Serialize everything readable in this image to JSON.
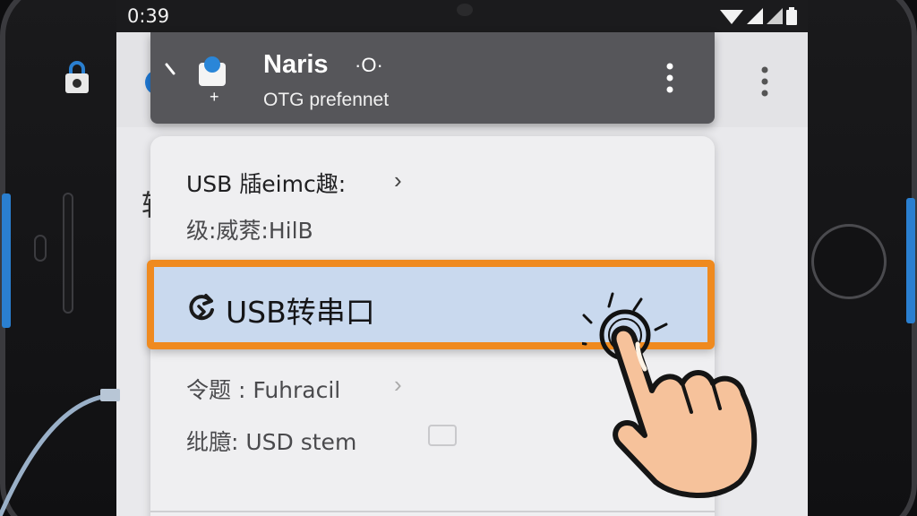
{
  "status_bar": {
    "time": "0:39",
    "icons": [
      "wifi-icon",
      "signal-icon",
      "signal-icon",
      "battery-icon"
    ]
  },
  "header": {
    "title": "Naris",
    "title_suffix": "·O·",
    "subtitle": "OTG prefennet",
    "avatar_badge": "+"
  },
  "menu": {
    "items": [
      {
        "label": "USB 牐eimc趣:",
        "has_chevron": true
      },
      {
        "label": "级:威萒:HilB",
        "has_chevron": false
      },
      {
        "label": "USB转串口",
        "selected": true,
        "icon": "refresh-icon"
      },
      {
        "label": "令题 : Fuhracil",
        "has_chevron": true
      },
      {
        "label": "纰臆: USD stem",
        "has_toggle": true
      }
    ]
  },
  "background_app": {
    "glyph": "转"
  },
  "colors": {
    "highlight_border": "#ef8a1f",
    "highlight_fill": "#c9d9ee",
    "header_bg": "#56565a",
    "accent_blue": "#1f7ad6"
  }
}
